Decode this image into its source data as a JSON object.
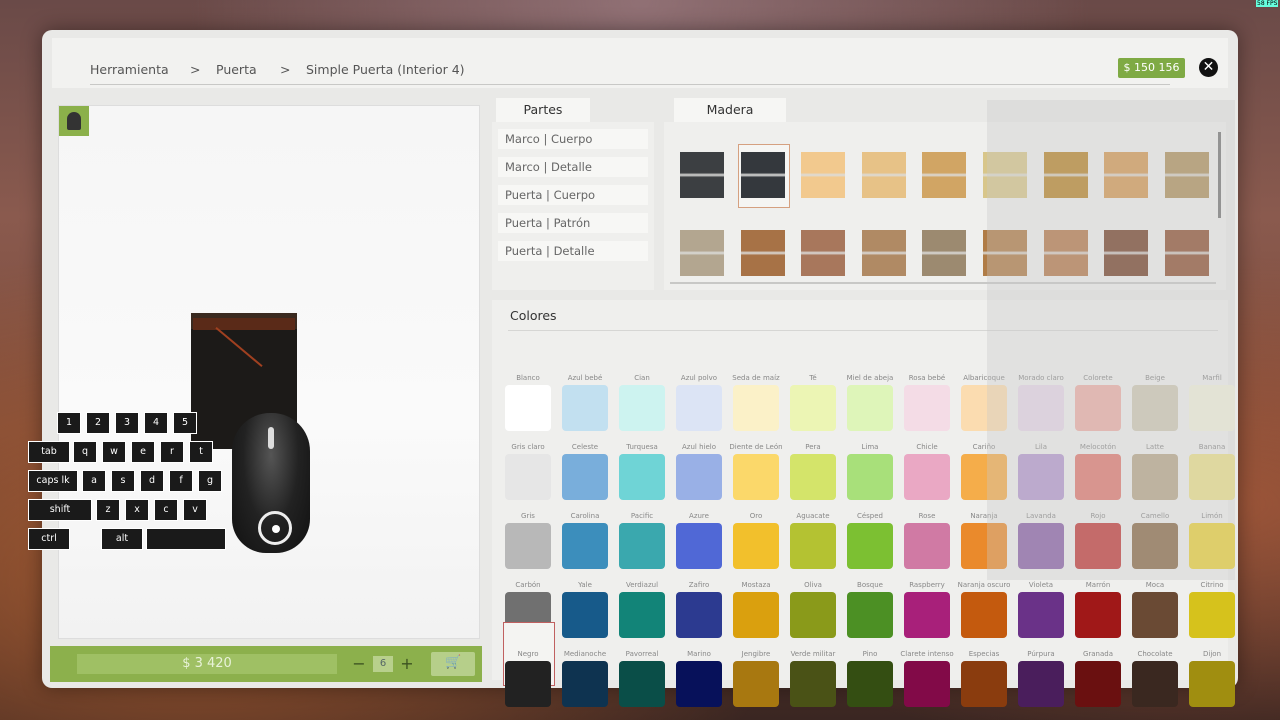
{
  "breadcrumb": {
    "level1": "Herramienta",
    "sep": ">",
    "level2": "Puerta",
    "level3": "Simple Puerta (Interior 4)"
  },
  "money": "$ 150 156",
  "close_icon": "close-icon",
  "fps": "58 FPS",
  "tabs": {
    "parts": "Partes",
    "material": "Madera",
    "colors": "Colores"
  },
  "parts": [
    "Marco | Cuerpo",
    "Marco | Detalle",
    "Puerta | Cuerpo",
    "Puerta | Patrón",
    "Puerta | Detalle"
  ],
  "wood_swatches": [
    {
      "color": "#3c3f42",
      "selected": false
    },
    {
      "color": "#34383d",
      "selected": true
    },
    {
      "color": "#f2c98e",
      "selected": false
    },
    {
      "color": "#e7c287",
      "selected": false
    },
    {
      "color": "#d1a564",
      "selected": false
    },
    {
      "color": "#d8c68a",
      "selected": false
    },
    {
      "color": "#b8862c",
      "selected": false
    },
    {
      "color": "#d59a55",
      "selected": false
    },
    {
      "color": "#b0925e",
      "selected": false
    },
    {
      "color": "#b3a690",
      "selected": false
    },
    {
      "color": "#a77246",
      "selected": false
    },
    {
      "color": "#a8775c",
      "selected": false
    },
    {
      "color": "#b08a64",
      "selected": false
    },
    {
      "color": "#9c8a70",
      "selected": false
    },
    {
      "color": "#b07c46",
      "selected": false
    },
    {
      "color": "#b57a4c",
      "selected": false
    },
    {
      "color": "#76422a",
      "selected": false
    },
    {
      "color": "#8f5233",
      "selected": false
    }
  ],
  "colors": [
    [
      {
        "name": "Blanco",
        "hex": "#ffffff"
      },
      {
        "name": "Azul bebé",
        "hex": "#c2e0f0"
      },
      {
        "name": "Cian",
        "hex": "#cdf3f0"
      },
      {
        "name": "Azul polvo",
        "hex": "#dce4f5"
      },
      {
        "name": "Seda de maíz",
        "hex": "#fbf1c8"
      },
      {
        "name": "Té",
        "hex": "#ecf5b4"
      },
      {
        "name": "Miel de abeja",
        "hex": "#def5b9"
      },
      {
        "name": "Rosa bebé",
        "hex": "#f4dce6"
      },
      {
        "name": "Albaricoque",
        "hex": "#fbdcb0"
      },
      {
        "name": "Morado claro",
        "hex": "#e6d8e8"
      },
      {
        "name": "Colorete",
        "hex": "#edb0a8"
      },
      {
        "name": "Beige",
        "hex": "#cfcab6"
      },
      {
        "name": "Marfil",
        "hex": "#f2f2dc"
      }
    ],
    [
      {
        "name": "Gris claro",
        "hex": "#e6e6e6"
      },
      {
        "name": "Celeste",
        "hex": "#79aedb"
      },
      {
        "name": "Turquesa",
        "hex": "#6fd4d6"
      },
      {
        "name": "Azul hielo",
        "hex": "#99b0e6"
      },
      {
        "name": "Diente de León",
        "hex": "#fbd86a"
      },
      {
        "name": "Pera",
        "hex": "#d4e46a"
      },
      {
        "name": "Lima",
        "hex": "#a8e07a"
      },
      {
        "name": "Chicle",
        "hex": "#eaa8c4"
      },
      {
        "name": "Cariño",
        "hex": "#f5ad4a"
      },
      {
        "name": "Lila",
        "hex": "#b59ad0"
      },
      {
        "name": "Melocotón",
        "hex": "#e07a70"
      },
      {
        "name": "Latte",
        "hex": "#b8a88a"
      },
      {
        "name": "Banana",
        "hex": "#ece08a"
      }
    ],
    [
      {
        "name": "Gris",
        "hex": "#b8b8b8"
      },
      {
        "name": "Carolina",
        "hex": "#3c8ebc"
      },
      {
        "name": "Pacific",
        "hex": "#3aa8ae"
      },
      {
        "name": "Azure",
        "hex": "#5068d6"
      },
      {
        "name": "Oro",
        "hex": "#f2c02c"
      },
      {
        "name": "Aguacate",
        "hex": "#b4c232"
      },
      {
        "name": "Césped",
        "hex": "#7cc032"
      },
      {
        "name": "Rose",
        "hex": "#d07aa4"
      },
      {
        "name": "Naranja",
        "hex": "#ea8a2c"
      },
      {
        "name": "Lavanda",
        "hex": "#8a62a8"
      },
      {
        "name": "Rojo",
        "hex": "#c23a38"
      },
      {
        "name": "Camello",
        "hex": "#8a6a48"
      },
      {
        "name": "Limón",
        "hex": "#ead23a"
      }
    ],
    [
      {
        "name": "Carbón",
        "hex": "#707070"
      },
      {
        "name": "Yale",
        "hex": "#175a8a"
      },
      {
        "name": "Verdiazul",
        "hex": "#128478"
      },
      {
        "name": "Zafiro",
        "hex": "#2c3a90"
      },
      {
        "name": "Mostaza",
        "hex": "#daa00e"
      },
      {
        "name": "Oliva",
        "hex": "#8a9a1a"
      },
      {
        "name": "Bosque",
        "hex": "#4c9024"
      },
      {
        "name": "Raspberry",
        "hex": "#a8207a"
      },
      {
        "name": "Naranja oscuro",
        "hex": "#c45a0e"
      },
      {
        "name": "Violeta",
        "hex": "#6a3288"
      },
      {
        "name": "Marrón",
        "hex": "#a01818"
      },
      {
        "name": "Moca",
        "hex": "#6a4a34"
      },
      {
        "name": "Citrino",
        "hex": "#d6c21c"
      }
    ],
    [
      {
        "name": "Negro",
        "hex": "#222222",
        "selected": true
      },
      {
        "name": "Medianoche",
        "hex": "#0e3350"
      },
      {
        "name": "Pavorreal",
        "hex": "#0a4e48"
      },
      {
        "name": "Marino",
        "hex": "#07115a"
      },
      {
        "name": "Jengibre",
        "hex": "#a87810"
      },
      {
        "name": "Verde militar",
        "hex": "#4a5216"
      },
      {
        "name": "Pino",
        "hex": "#344e12"
      },
      {
        "name": "Clarete intenso",
        "hex": "#820a48"
      },
      {
        "name": "Especias",
        "hex": "#8a3c0e"
      },
      {
        "name": "Púrpura",
        "hex": "#4a1e5c"
      },
      {
        "name": "Granada",
        "hex": "#6a1010"
      },
      {
        "name": "Chocolate",
        "hex": "#3a2820"
      },
      {
        "name": "Dijon",
        "hex": "#a08e10"
      }
    ]
  ],
  "buy_bar": {
    "price": "$ 3 420",
    "minus": "−",
    "quantity": "6",
    "plus": "+",
    "cart_icon": "cart-icon"
  },
  "keyboard": {
    "row1": [
      "1",
      "2",
      "3",
      "4",
      "5"
    ],
    "row2": [
      "tab",
      "q",
      "w",
      "e",
      "r",
      "t"
    ],
    "row3": [
      "caps lk",
      "a",
      "s",
      "d",
      "f",
      "g"
    ],
    "row4": [
      "shift",
      "z",
      "x",
      "c",
      "v"
    ],
    "row5": [
      "ctrl",
      "alt",
      ""
    ]
  },
  "mouse_icon": "mouse-icon"
}
